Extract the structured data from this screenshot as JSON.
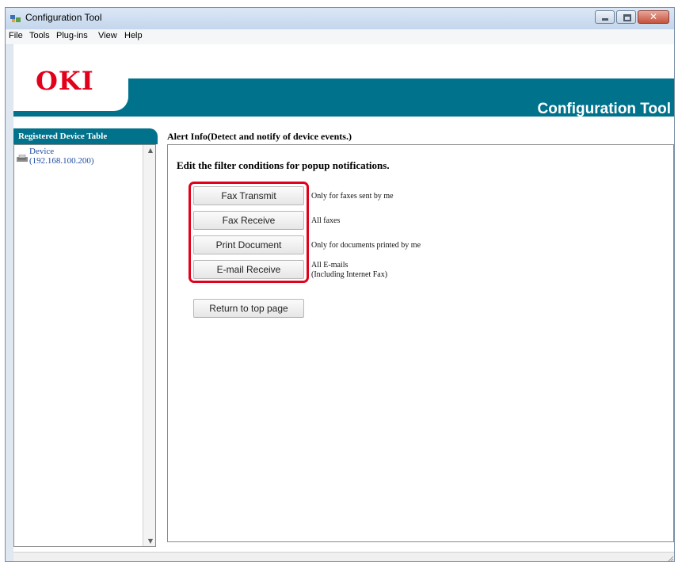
{
  "window": {
    "title": "Configuration Tool"
  },
  "menu": [
    {
      "label": "File"
    },
    {
      "label": "Tools"
    },
    {
      "label": "Plug-ins"
    },
    {
      "label": "View"
    },
    {
      "label": "Help"
    }
  ],
  "banner": {
    "logo": "OKI",
    "product_title": "Configuration Tool"
  },
  "sidebar": {
    "header": "Registered Device Table",
    "device_name": "Device",
    "device_ip": "(192.168.100.200)"
  },
  "main": {
    "header": "Alert Info(Detect and notify of device events.)",
    "section_title": "Edit the filter conditions for popup notifications.",
    "buttons": [
      {
        "label": "Fax Transmit",
        "description": "Only for faxes sent by me"
      },
      {
        "label": "Fax Receive",
        "description": "All faxes"
      },
      {
        "label": "Print Document",
        "description": "Only for documents printed by me"
      },
      {
        "label": "E-mail Receive",
        "description": "All E-mails",
        "description2": "(Including Internet Fax)"
      }
    ],
    "return_button": "Return to top page"
  },
  "colors": {
    "accent": "#00728c",
    "logo": "#e2001a",
    "highlight": "#e2001a"
  }
}
